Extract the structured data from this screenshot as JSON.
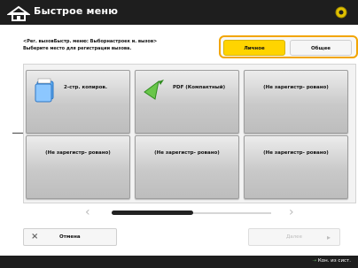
{
  "header": {
    "title": "Быстрое меню"
  },
  "instruction": {
    "line1": "<Рег. вызовБыстр. меню: Выборнастроек и. вызов>",
    "line2": "Выберите место для регистрации вызова."
  },
  "toggle": {
    "personal": "Личное",
    "shared": "Общее"
  },
  "tiles": [
    {
      "label": "2-стр. копиров.",
      "icon": "copy-icon"
    },
    {
      "label": "PDF (Компактный)",
      "icon": "send-icon"
    },
    {
      "label": "(Не зарегистр- ровано)",
      "icon": ""
    },
    {
      "label": "(Не зарегистр- ровано)",
      "icon": ""
    },
    {
      "label": "(Не зарегистр- ровано)",
      "icon": ""
    },
    {
      "label": "(Не зарегистр- ровано)",
      "icon": ""
    }
  ],
  "footer_buttons": {
    "cancel": "Отмена",
    "next": "Далее"
  },
  "status": {
    "text": "Кон. из сист."
  },
  "colors": {
    "accent": "#ffd400",
    "toggle_border": "#f2a500",
    "header_bg": "#1e1e1e"
  }
}
